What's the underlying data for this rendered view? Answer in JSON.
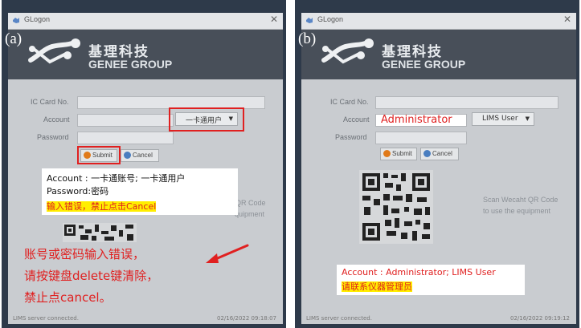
{
  "window_title": "GLogon",
  "brand": {
    "cn": "基理科技",
    "en": "GENEE GROUP"
  },
  "form": {
    "ic_card_label": "IC Card No.",
    "account_label": "Account",
    "password_label": "Password",
    "submit_label": "Submit",
    "cancel_label": "Cancel"
  },
  "qr_text": {
    "line1": "Scan Wecaht QR Code",
    "line2": "to use the equipment"
  },
  "status": {
    "left": "LIMS server connected.",
    "right_a": "02/16/2022 09:18:07",
    "right_b": "02/16/2022 09:19:12"
  },
  "panel_a": {
    "label": "(a)",
    "account_user_type": "一卡通用户",
    "note_line1": "Account : 一卡通账号; 一卡通用户",
    "note_line2": "Password:密码",
    "note_warning": "输入错误，禁止点击Cancel",
    "qr_fragment_1": "t QR Code",
    "qr_fragment_2": "quipment",
    "big_note": [
      "账号或密码输入错误，",
      "请按键盘delete键清除，",
      "禁止点cancel。"
    ]
  },
  "panel_b": {
    "label": "(b)",
    "account_value": "Administrator",
    "user_type": "LIMS User",
    "note_line1": "Account : Administrator; LIMS User",
    "note_highlight": "请联系仪器管理员"
  },
  "colors": {
    "red": "#e02020",
    "highlight": "#ffee00",
    "submit_icon": "#e07a1a",
    "cancel_icon": "#4a7ec0"
  }
}
